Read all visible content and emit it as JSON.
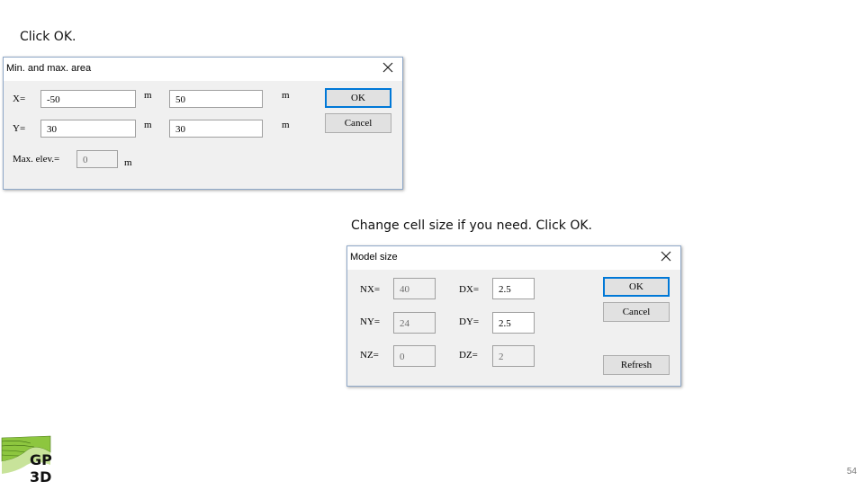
{
  "captions": {
    "first": "Click OK.",
    "second": "Change cell size if you need. Click OK."
  },
  "dialog_area": {
    "title": "Min. and max. area",
    "x_label": "X=",
    "x_min": "-50",
    "x_unit1": "m",
    "x_max": "50",
    "x_unit2": "m",
    "y_label": "Y=",
    "y_min": "30",
    "y_unit1": "m",
    "y_max": "30",
    "y_unit2": "m",
    "elev_label": "Max. elev.=",
    "elev_value": "0",
    "elev_unit": "m",
    "ok_label": "OK",
    "cancel_label": "Cancel"
  },
  "dialog_model": {
    "title": "Model size",
    "nx_label": "NX=",
    "nx_value": "40",
    "ny_label": "NY=",
    "ny_value": "24",
    "nz_label": "NZ=",
    "nz_value": "0",
    "dx_label": "DX=",
    "dx_value": "2.5",
    "dy_label": "DY=",
    "dy_value": "2.5",
    "dz_label": "DZ=",
    "dz_value": "2",
    "ok_label": "OK",
    "cancel_label": "Cancel",
    "refresh_label": "Refresh"
  },
  "logo": {
    "text_top": "GP",
    "text_bottom": "3D",
    "icon": "gp3d-logo-icon",
    "accent": "#8dc63f"
  },
  "page_number": "54",
  "colors": {
    "dialog_bg": "#f0f0f0",
    "default_button_border": "#0078d7"
  }
}
